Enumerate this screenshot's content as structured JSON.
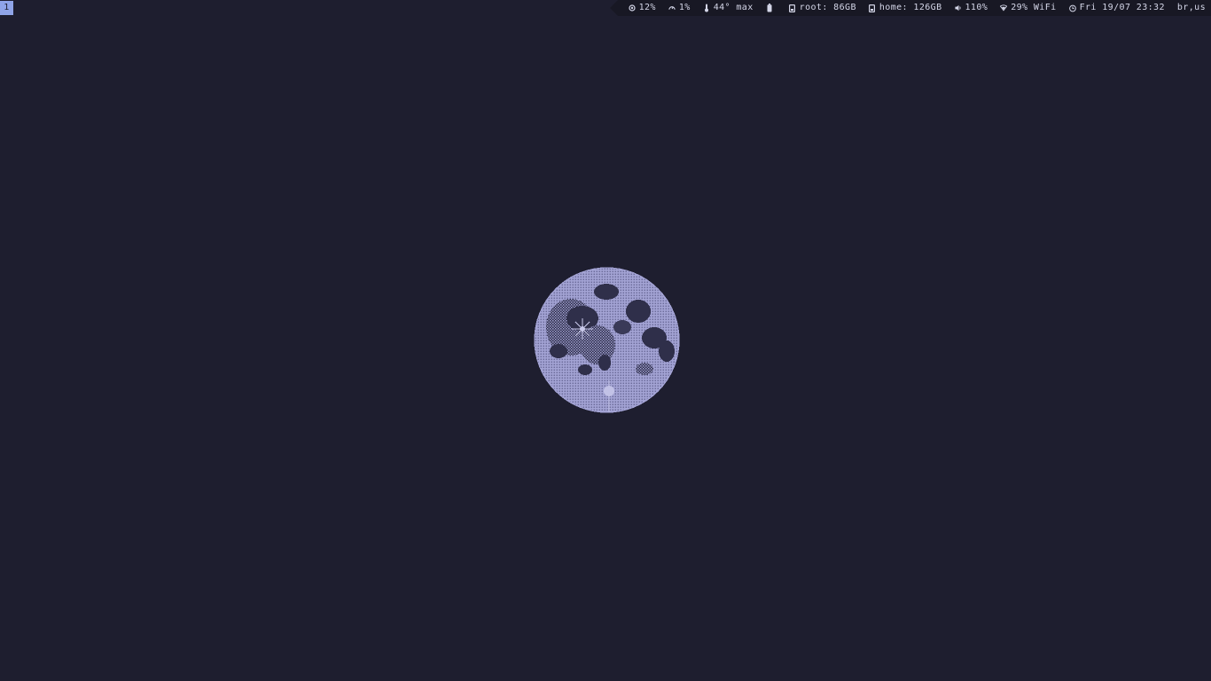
{
  "workspace": {
    "label": "1"
  },
  "status": {
    "cpu": {
      "icon": "cpu-icon",
      "value": "12%"
    },
    "memory": {
      "icon": "gauge-icon",
      "value": "1%"
    },
    "temperature": {
      "icon": "thermometer-icon",
      "value": "44° max"
    },
    "battery": {
      "icon": "battery-icon"
    },
    "root_disk": {
      "icon": "disk-icon",
      "value": "root: 86GB"
    },
    "home_disk": {
      "icon": "disk-icon",
      "value": "home: 126GB"
    },
    "volume": {
      "icon": "speaker-icon",
      "value": "110%"
    },
    "wifi": {
      "icon": "wifi-icon",
      "value": "29% WiFi"
    },
    "clock": {
      "icon": "clock-icon",
      "value": "Fri 19/07 23:32"
    },
    "keyboard_layout": {
      "value": "br,us"
    }
  },
  "wallpaper": {
    "subject": "pixel-moon"
  },
  "colors": {
    "background": "#1e1e2f",
    "bar_text": "#d4d6e8",
    "workspace_active": "#8fa4e8",
    "moon_light": "#a3a3d4",
    "moon_dark": "#2a2a44"
  }
}
